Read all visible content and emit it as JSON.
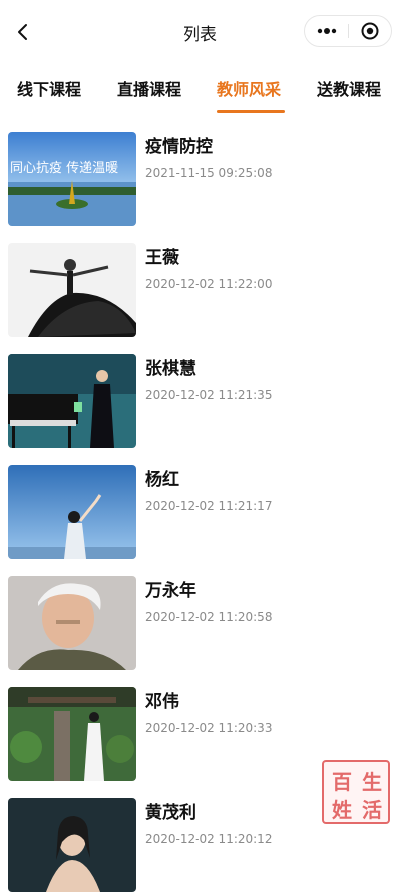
{
  "nav": {
    "title": "列表"
  },
  "tabs": [
    {
      "label": "线下课程",
      "active": false
    },
    {
      "label": "直播课程",
      "active": false
    },
    {
      "label": "教师风采",
      "active": true
    },
    {
      "label": "送教课程",
      "active": false
    }
  ],
  "accent": "#e8761e",
  "items": [
    {
      "name": "疫情防控",
      "date": "2021-11-15 09:25:08",
      "thumb_text": "同心抗疫 传递温暖"
    },
    {
      "name": "王薇",
      "date": "2020-12-02 11:22:00"
    },
    {
      "name": "张棋慧",
      "date": "2020-12-02 11:21:35"
    },
    {
      "name": "杨红",
      "date": "2020-12-02 11:21:17"
    },
    {
      "name": "万永年",
      "date": "2020-12-02 11:20:58"
    },
    {
      "name": "邓伟",
      "date": "2020-12-02 11:20:33"
    },
    {
      "name": "黄茂利",
      "date": "2020-12-02 11:20:12"
    }
  ],
  "watermark": {
    "chars": [
      "百",
      "生",
      "姓",
      "活"
    ]
  }
}
